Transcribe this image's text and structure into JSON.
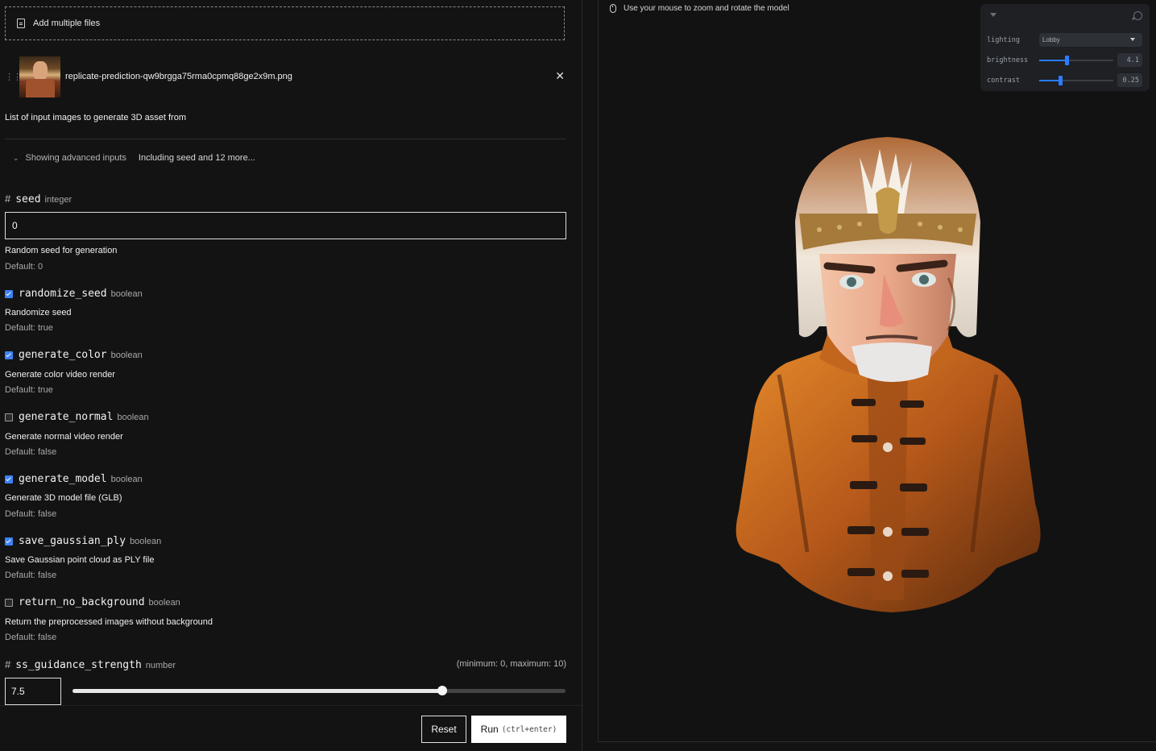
{
  "upload": {
    "add_label": "Add multiple files",
    "file_name": "replicate-prediction-qw9brgga75rma0cpmq88ge2x9m.png",
    "help_text": "List of input images to generate 3D asset from"
  },
  "advanced": {
    "label": "Showing advanced inputs",
    "summary": "Including seed and 12 more..."
  },
  "fields": {
    "seed": {
      "name": "seed",
      "type": "integer",
      "value": "0",
      "description": "Random seed for generation",
      "default": "Default: 0"
    },
    "randomize_seed": {
      "name": "randomize_seed",
      "type": "boolean",
      "checked": true,
      "description": "Randomize seed",
      "default": "Default: true"
    },
    "generate_color": {
      "name": "generate_color",
      "type": "boolean",
      "checked": true,
      "description": "Generate color video render",
      "default": "Default: true"
    },
    "generate_normal": {
      "name": "generate_normal",
      "type": "boolean",
      "checked": false,
      "description": "Generate normal video render",
      "default": "Default: false"
    },
    "generate_model": {
      "name": "generate_model",
      "type": "boolean",
      "checked": true,
      "description": "Generate 3D model file (GLB)",
      "default": "Default: false"
    },
    "save_gaussian_ply": {
      "name": "save_gaussian_ply",
      "type": "boolean",
      "checked": true,
      "description": "Save Gaussian point cloud as PLY file",
      "default": "Default: false"
    },
    "return_no_background": {
      "name": "return_no_background",
      "type": "boolean",
      "checked": false,
      "description": "Return the preprocessed images without background",
      "default": "Default: false"
    },
    "ss_guidance_strength": {
      "name": "ss_guidance_strength",
      "type": "number",
      "value": "7.5",
      "range_note": "(minimum: 0, maximum: 10)",
      "min": 0,
      "max": 10,
      "current": 7.5
    }
  },
  "actions": {
    "reset_label": "Reset",
    "run_label": "Run",
    "run_hint": "(ctrl+enter)"
  },
  "viewer": {
    "hint": "Use your mouse to zoom and rotate the model",
    "controls": {
      "lighting_label": "lighting",
      "lighting_value": "Lobby",
      "brightness_label": "brightness",
      "brightness_value": "4.1",
      "brightness_level": 0.37,
      "contrast_label": "contrast",
      "contrast_value": "0.25",
      "contrast_level": 0.28
    },
    "accent_color": "#2b7cff"
  },
  "icons": [
    "file-icon",
    "drag-handle-icon",
    "close-icon",
    "chevron-down-icon",
    "hash-icon",
    "checkbox-icon",
    "mouse-icon",
    "collapse-triangle-icon",
    "search-icon",
    "dropdown-caret-icon"
  ]
}
